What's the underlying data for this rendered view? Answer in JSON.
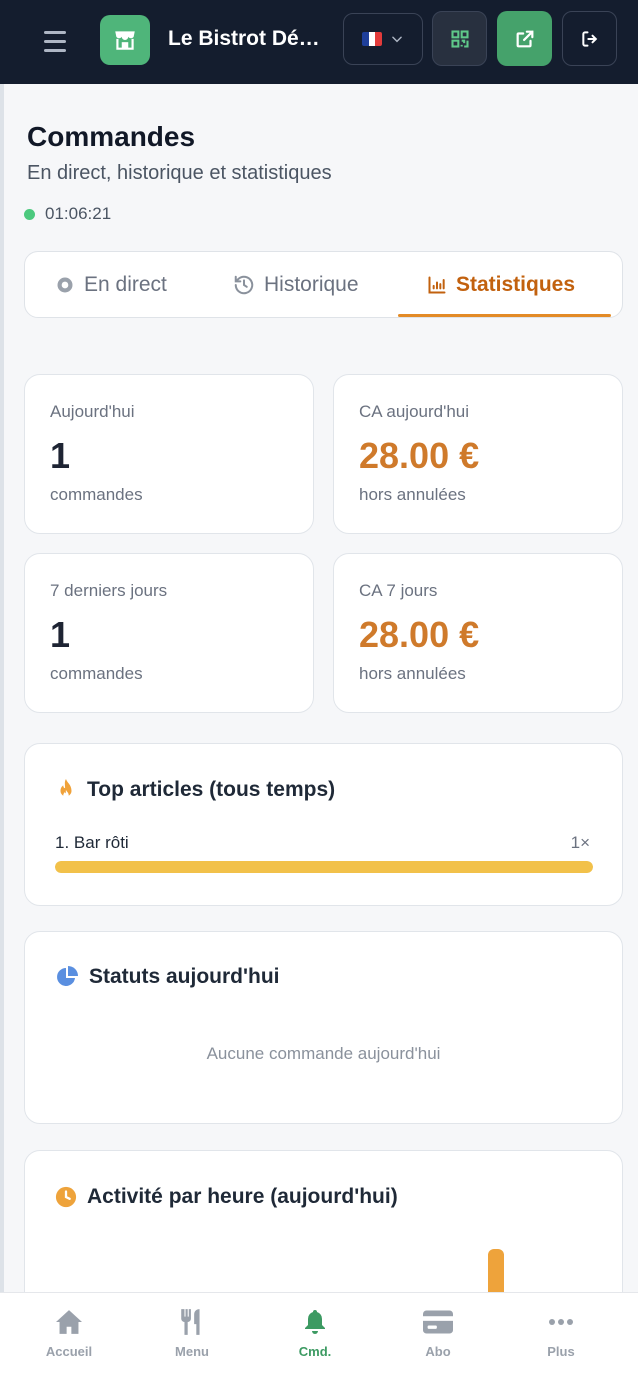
{
  "header": {
    "title": "Le Bistrot Dé…",
    "flag_colors": [
      "#1f3f9a",
      "#ffffff",
      "#e23b3b"
    ]
  },
  "page": {
    "title": "Commandes",
    "subtitle": "En direct, historique et statistiques",
    "live_time": "01:06:21"
  },
  "tabs": [
    {
      "label": "En direct",
      "icon": "radio-icon"
    },
    {
      "label": "Historique",
      "icon": "history-icon"
    },
    {
      "label": "Statistiques",
      "icon": "chart-icon",
      "active": true
    }
  ],
  "stats": [
    {
      "label": "Aujourd'hui",
      "value": "1",
      "note": "commandes"
    },
    {
      "label": "CA aujourd'hui",
      "value": "28.00 €",
      "note": "hors annulées"
    },
    {
      "label": "7 derniers jours",
      "value": "1",
      "note": "commandes"
    },
    {
      "label": "CA 7 jours",
      "value": "28.00 €",
      "note": "hors annulées"
    }
  ],
  "top_articles": {
    "title": "Top articles (tous temps)",
    "items": [
      {
        "label": "1. Bar rôti",
        "count": "1×",
        "share": 1.0
      }
    ]
  },
  "status_today": {
    "title": "Statuts aujourd'hui",
    "empty": "Aucune commande aujourd'hui"
  },
  "hourly": {
    "title": "Activité par heure (aujourd'hui)"
  },
  "bottom_nav": [
    {
      "label": "Accueil",
      "icon": "home-icon"
    },
    {
      "label": "Menu",
      "icon": "utensils-icon"
    },
    {
      "label": "Cmd.",
      "icon": "bell-icon",
      "active": true
    },
    {
      "label": "Abo",
      "icon": "card-icon"
    },
    {
      "label": "Plus",
      "icon": "more-icon"
    }
  ],
  "colors": {
    "accent": "#c2610e",
    "money": "#cf7a2b",
    "brand": "#4fb57a",
    "live": "#4cc97e"
  }
}
